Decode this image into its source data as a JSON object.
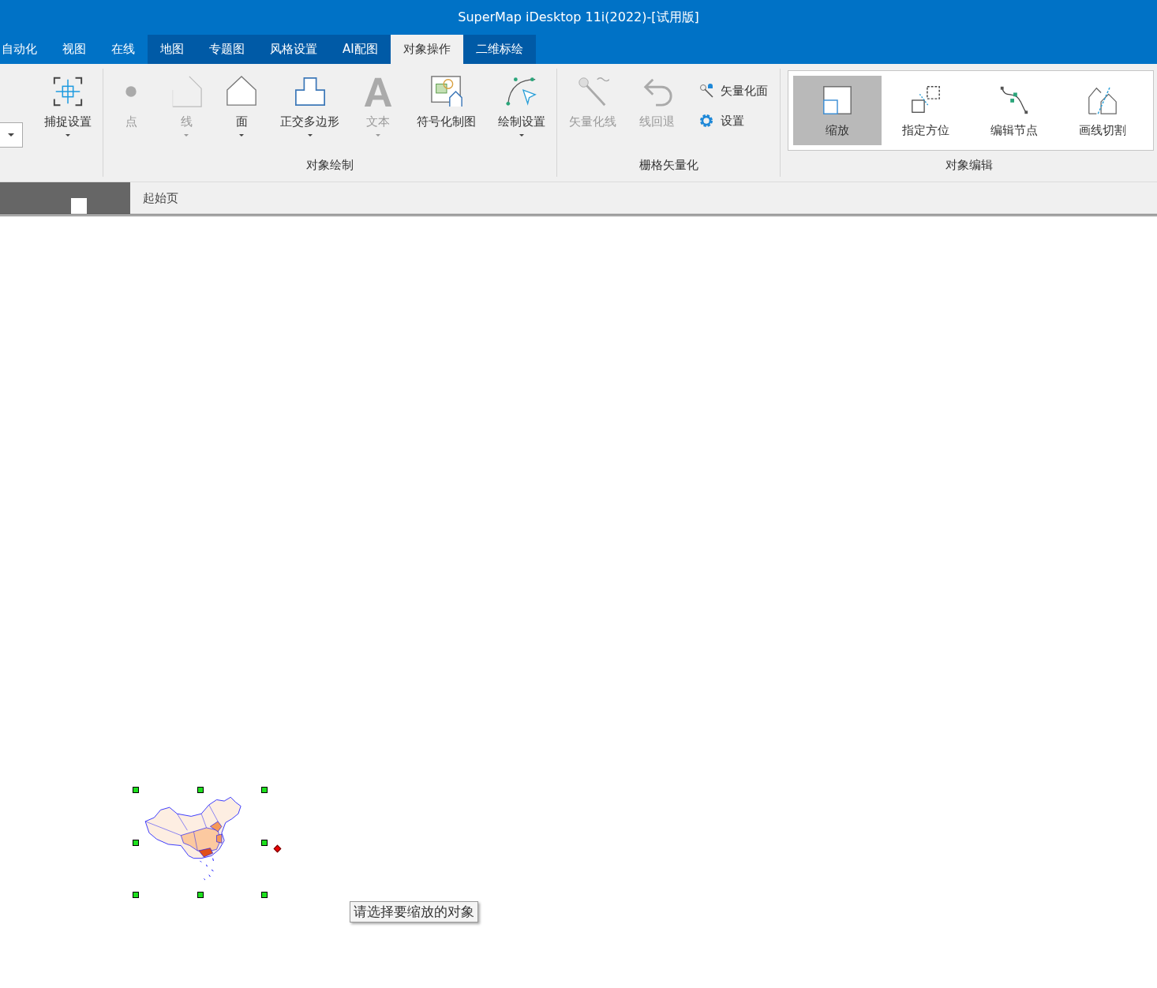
{
  "window": {
    "title": "SuperMap iDesktop 11i(2022)-[试用版]"
  },
  "tabs": [
    {
      "label": "自动化",
      "selected": false,
      "contextual": false
    },
    {
      "label": "视图",
      "selected": false,
      "contextual": false
    },
    {
      "label": "在线",
      "selected": false,
      "contextual": false
    },
    {
      "label": "地图",
      "selected": false,
      "contextual": true
    },
    {
      "label": "专题图",
      "selected": false,
      "contextual": true
    },
    {
      "label": "风格设置",
      "selected": false,
      "contextual": true
    },
    {
      "label": "AI配图",
      "selected": false,
      "contextual": true
    },
    {
      "label": "对象操作",
      "selected": true,
      "contextual": true
    },
    {
      "label": "二维标绘",
      "selected": false,
      "contextual": true
    }
  ],
  "ribbon": {
    "groups": [
      {
        "items": [
          {
            "kind": "combo",
            "dropdown": true
          },
          {
            "kind": "large",
            "label": "捕捉设置",
            "disabled": false,
            "dropdown": true
          }
        ]
      },
      {
        "label": "对象绘制",
        "items": [
          {
            "kind": "large",
            "label": "点",
            "disabled": true,
            "dropdown": false
          },
          {
            "kind": "large",
            "label": "线",
            "disabled": true,
            "dropdown": true
          },
          {
            "kind": "large",
            "label": "面",
            "disabled": false,
            "dropdown": true
          },
          {
            "kind": "large",
            "label": "正交多边形",
            "disabled": false,
            "dropdown": true
          },
          {
            "kind": "large",
            "label": "文本",
            "disabled": true,
            "dropdown": true
          },
          {
            "kind": "large",
            "label": "符号化制图",
            "disabled": false,
            "dropdown": false
          },
          {
            "kind": "large",
            "label": "绘制设置",
            "disabled": false,
            "dropdown": true
          }
        ]
      },
      {
        "label": "栅格矢量化",
        "items": [
          {
            "kind": "large",
            "label": "矢量化线",
            "disabled": true,
            "dropdown": false
          },
          {
            "kind": "large",
            "label": "线回退",
            "disabled": true,
            "dropdown": false
          },
          {
            "kind": "small",
            "label": "矢量化面",
            "disabled": false
          },
          {
            "kind": "small",
            "label": "设置",
            "disabled": false
          }
        ]
      },
      {
        "label": "对象编辑",
        "items": [
          {
            "kind": "gallery",
            "label": "缩放",
            "selected": true
          },
          {
            "kind": "gallery",
            "label": "指定方位",
            "selected": false
          },
          {
            "kind": "gallery",
            "label": "编辑节点",
            "selected": false
          },
          {
            "kind": "gallery",
            "label": "画线切割",
            "selected": false
          }
        ]
      }
    ]
  },
  "document_tabs": [
    {
      "label": "起始页",
      "selected": false
    }
  ],
  "map": {
    "selected": true
  },
  "tooltip": "请选择要缩放的对象"
}
